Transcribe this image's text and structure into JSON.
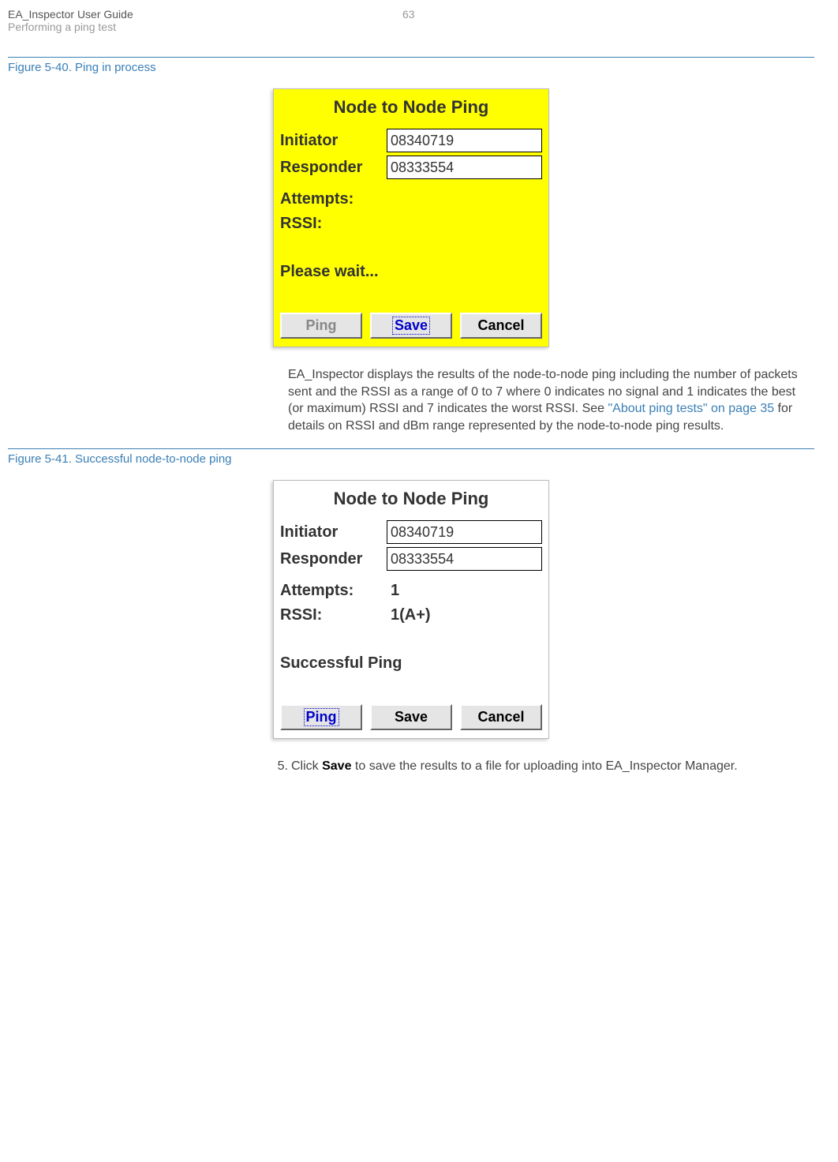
{
  "header": {
    "title": "EA_Inspector User Guide",
    "subtitle": "Performing a ping test",
    "page_number": "63"
  },
  "figure1": {
    "caption": "Figure 5-40. Ping in process",
    "title": "Node to Node Ping",
    "initiator_label": "Initiator",
    "initiator_value": "08340719",
    "responder_label": "Responder",
    "responder_value": "08333554",
    "attempts_label": "Attempts:",
    "attempts_value": "",
    "rssi_label": "RSSI:",
    "rssi_value": "",
    "status": "Please wait...",
    "btn_ping": "Ping",
    "btn_save": "Save",
    "btn_cancel": "Cancel"
  },
  "paragraph1": {
    "before_link": "EA_Inspector displays the results of the node-to-node ping including the number of packets sent and the RSSI as a range of 0 to 7 where 0 indicates no signal and 1 indicates the best (or maximum) RSSI and 7 indicates the worst RSSI. See ",
    "link": "\"About ping tests\" on page 35",
    "after_link": " for details on RSSI and dBm range represented by the node-to-node ping results."
  },
  "figure2": {
    "caption": "Figure 5-41. Successful node-to-node ping",
    "title": "Node to Node Ping",
    "initiator_label": "Initiator",
    "initiator_value": "08340719",
    "responder_label": "Responder",
    "responder_value": "08333554",
    "attempts_label": "Attempts:",
    "attempts_value": "1",
    "rssi_label": "RSSI:",
    "rssi_value": "1(A+)",
    "status": "Successful Ping",
    "btn_ping": "Ping",
    "btn_save": "Save",
    "btn_cancel": "Cancel"
  },
  "step5": {
    "number": "5.",
    "before_bold": "Click ",
    "bold": "Save",
    "after_bold": " to save the results to a file for uploading into EA_Inspector Manager."
  }
}
